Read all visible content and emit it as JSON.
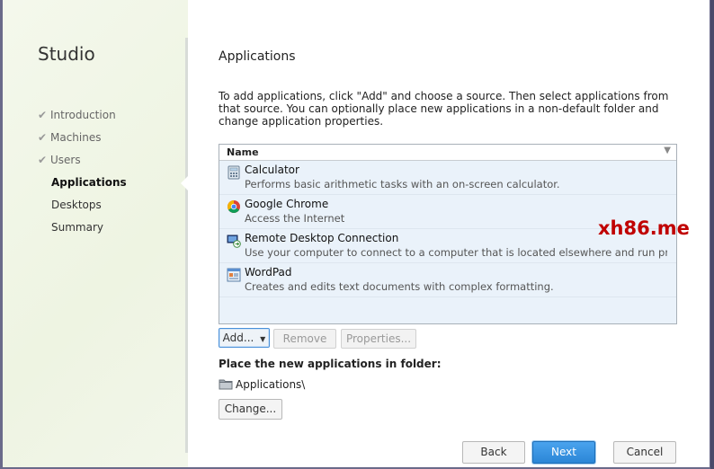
{
  "sidebar": {
    "title": "Studio",
    "steps": [
      {
        "label": "Introduction",
        "done": true
      },
      {
        "label": "Machines",
        "done": true
      },
      {
        "label": "Users",
        "done": true
      },
      {
        "label": "Applications",
        "current": true
      },
      {
        "label": "Desktops"
      },
      {
        "label": "Summary"
      }
    ]
  },
  "main": {
    "title": "Applications",
    "intro": "To add applications, click \"Add\" and choose a source. Then select applications from that source. You can optionally place new applications in a non-default folder and change application properties.",
    "list": {
      "column": "Name",
      "items": [
        {
          "name": "Calculator",
          "desc": "Performs basic arithmetic tasks with an on-screen calculator.",
          "icon": "calculator-icon"
        },
        {
          "name": "Google Chrome",
          "desc": "Access the Internet",
          "icon": "chrome-icon"
        },
        {
          "name": "Remote Desktop Connection",
          "desc": "Use your computer to connect to a computer that is located elsewhere and run progra...",
          "icon": "remote-desktop-icon"
        },
        {
          "name": "WordPad",
          "desc": "Creates and edits text documents with complex formatting.",
          "icon": "wordpad-icon"
        }
      ]
    },
    "buttons": {
      "add": "Add...",
      "remove": "Remove",
      "properties": "Properties..."
    },
    "folder": {
      "label": "Place the new applications in folder:",
      "path": "Applications\\",
      "change": "Change..."
    }
  },
  "footer": {
    "back": "Back",
    "next": "Next",
    "cancel": "Cancel"
  },
  "watermark": "xh86.me"
}
